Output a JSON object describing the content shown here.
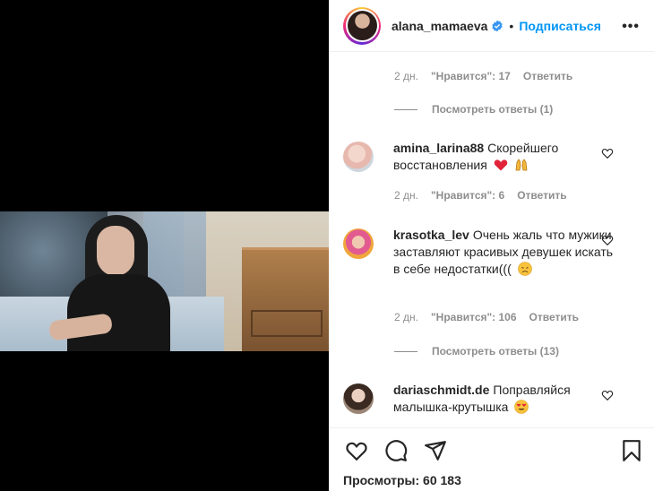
{
  "header": {
    "username": "alana_mamaeva",
    "separator": "•",
    "follow_label": "Подписаться",
    "more_label": "•••"
  },
  "comments_top": {
    "meta": {
      "time": "2 дн.",
      "likes": "\"Нравится\": 17",
      "reply": "Ответить"
    },
    "view_replies": "Посмотреть ответы (1)"
  },
  "comments": [
    {
      "username": "amina_larina88",
      "text": "Скорейшего восстановления",
      "emojis": [
        "heart-emoji",
        "raised-hands-emoji"
      ],
      "meta": {
        "time": "2 дн.",
        "likes": "\"Нравится\": 6",
        "reply": "Ответить"
      }
    },
    {
      "username": "krasotka_lev",
      "text": "Очень жаль что мужики заставляют красивых девушек искать в себе недостатки(((",
      "emojis": [
        "disappointed-face-emoji"
      ],
      "meta": {
        "time": "2 дн.",
        "likes": "\"Нравится\": 106",
        "reply": "Ответить"
      },
      "view_replies": "Посмотреть ответы (13)"
    },
    {
      "username": "dariaschmidt.de",
      "text": "Поправляйся малышка-крутышка",
      "emojis": [
        "heart-eyes-emoji"
      ]
    }
  ],
  "actions": {
    "views": "Просмотры: 60 183",
    "icons": [
      "heart-icon",
      "comment-icon",
      "share-icon",
      "bookmark-icon"
    ]
  },
  "colors": {
    "accent": "#0095f6",
    "muted": "#8e8e8e",
    "text": "#262626",
    "heart": "#ed4956"
  }
}
